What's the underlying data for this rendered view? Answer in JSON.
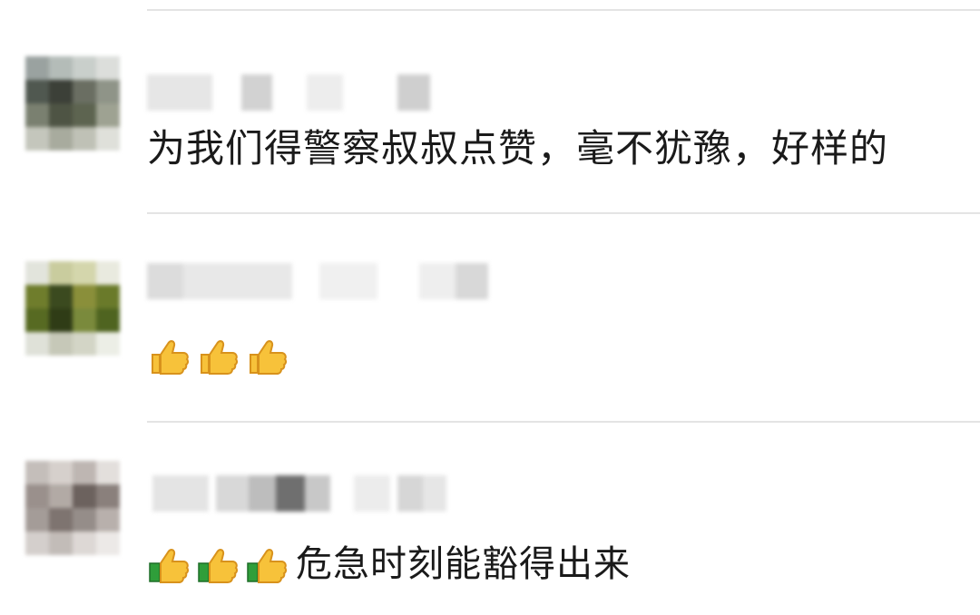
{
  "comments": [
    {
      "avatar_icon": "blurred-avatar",
      "nickname": "",
      "text": "为我们得警察叔叔点赞，毫不犹豫，好样的"
    },
    {
      "avatar_icon": "blurred-avatar",
      "nickname": "",
      "emojis": [
        "thumbs-up-icon",
        "thumbs-up-icon",
        "thumbs-up-icon"
      ],
      "text": ""
    },
    {
      "avatar_icon": "blurred-avatar",
      "nickname": "",
      "emojis": [
        "thumbs-up-icon",
        "thumbs-up-icon",
        "thumbs-up-icon"
      ],
      "text": "危急时刻能豁得出来"
    }
  ],
  "colors": {
    "divider": "#e4e4e4",
    "text": "#1a1a1a",
    "thumb_fill": "#f7c23a",
    "thumb_edge": "#d8921c",
    "cuff_green": "#2f9e3a"
  }
}
